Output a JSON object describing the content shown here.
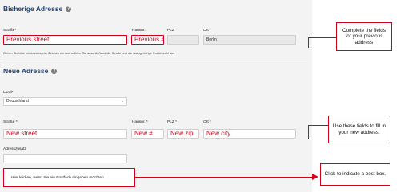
{
  "old_address": {
    "title": "Bisherige Adresse",
    "street_label": "Straße*",
    "house_label": "Hausnr.*",
    "zip_label": "PLZ",
    "city_label": "Ort",
    "street_value": "Previous street",
    "house_value": "Previous #",
    "zip_value": "",
    "city_value": "Berlin",
    "hint": "Geben Sie bitte mindestens vier Zeichen ein und wählen Sie anschließend die Straße und die dazugehörige Postleitzahl aus."
  },
  "new_address": {
    "title": "Neue Adresse",
    "country_label": "Land*",
    "country_value": "Deutschland",
    "street_label": "Straße *",
    "house_label": "Hausnr. *",
    "zip_label": "PLZ *",
    "city_label": "Ort *",
    "street_value": "New street",
    "house_value": "New #",
    "zip_value": "New zip",
    "city_value": "New city",
    "addition_label": "Adresszusatz",
    "addition_value": "",
    "postbox_link": "Hier klicken, wenn Sie ein Postfach eingeben möchten"
  },
  "callouts": {
    "previous": "Complete the fields for your previous address",
    "new": "Use these fields to fill in your new address.",
    "postbox": "Click to indicate a post box."
  },
  "icons": {
    "help": "help-circle-icon",
    "dropdown": "chevron-down-icon"
  },
  "colors": {
    "accent": "#d0021b",
    "heading": "#1d3f6e",
    "panel": "#f3f3f3"
  }
}
